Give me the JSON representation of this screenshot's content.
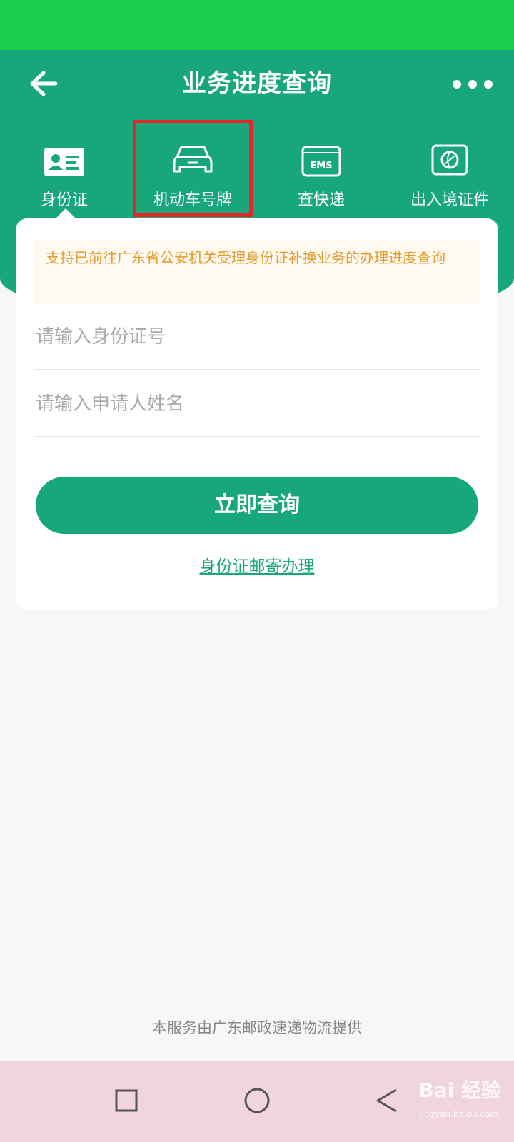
{
  "header": {
    "title": "业务进度查询"
  },
  "tabs": [
    {
      "label": "身份证",
      "icon": "id-card-icon",
      "active": true
    },
    {
      "label": "机动车号牌",
      "icon": "car-icon",
      "highlighted": true
    },
    {
      "label": "查快递",
      "icon": "ems-icon",
      "icon_text": "EMS"
    },
    {
      "label": "出入境证件",
      "icon": "passport-icon"
    }
  ],
  "form": {
    "notice": "支持已前往广东省公安机关受理身份证补换业务的办理进度查询",
    "id_placeholder": "请输入身份证号",
    "name_placeholder": "请输入申请人姓名",
    "submit_label": "立即查询",
    "mail_link": "身份证邮寄办理"
  },
  "footer": {
    "note": "本服务由广东邮政速递物流提供"
  },
  "watermark": {
    "brand": "Bai 经验",
    "url": "jingyan.baidu.com"
  },
  "colors": {
    "primary": "#18a77b",
    "status_bar": "#19cf4b",
    "notice_text": "#e39a2e",
    "highlight": "#e8262a"
  }
}
